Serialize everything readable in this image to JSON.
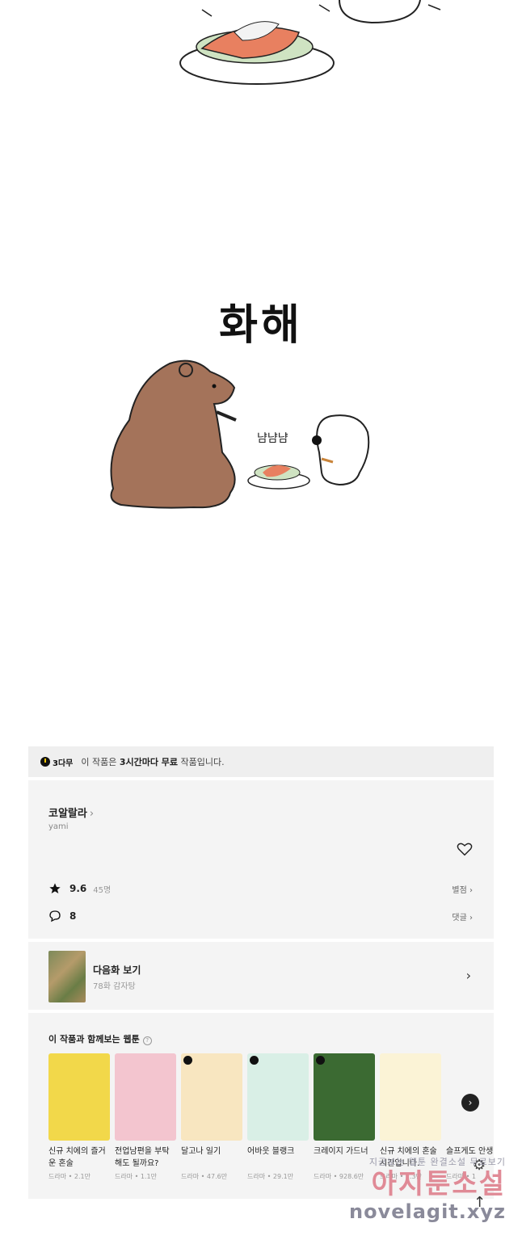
{
  "comic": {
    "panel_title": "화해",
    "sound_effect": "냠냠냠"
  },
  "free_bar": {
    "badge": "3다무",
    "text_prefix": "이 작품은 ",
    "text_bold": "3시간마다 무료",
    "text_suffix": " 작품입니다."
  },
  "work": {
    "title": "코알랄라",
    "author": "yami",
    "rating": "9.6",
    "rating_count": "45명",
    "rate_link": "별점",
    "comment_count": "8",
    "comment_link": "댓글"
  },
  "next_episode": {
    "label": "다음화 보기",
    "subtitle": "78화 감자탕"
  },
  "recommend": {
    "title": "이 작품과 함께보는 웹툰",
    "items": [
      {
        "title": "신규 치에의 즐거운 혼술",
        "meta": "드라마 • 2.1만",
        "color": "#f2d84a"
      },
      {
        "title": "전업남편을 부탁해도 될까요?",
        "meta": "드라마 • 1.1만",
        "color": "#f3c5cf"
      },
      {
        "title": "달고나 일기",
        "meta": "드라마 • 47.6만",
        "color": "#f8e6c0"
      },
      {
        "title": "어바웃 블랭크",
        "meta": "드라마 • 29.1만",
        "color": "#d9efe6"
      },
      {
        "title": "크레이지 가드너",
        "meta": "드라마 • 928.6만",
        "color": "#3b6a32"
      },
      {
        "title": "신규 치에의 혼술 시간입니다.",
        "meta": "드라마 • 2.3만",
        "color": "#fbf3d6"
      },
      {
        "title": "슬프게도 안생",
        "meta": "드라마 • 1",
        "color": "#f4f4f4"
      }
    ]
  },
  "watermark": {
    "line1": "지금보는 웹툰 완결소설 무료보기",
    "line2": "아지툰소설",
    "line3": "novelagit.xyz"
  }
}
